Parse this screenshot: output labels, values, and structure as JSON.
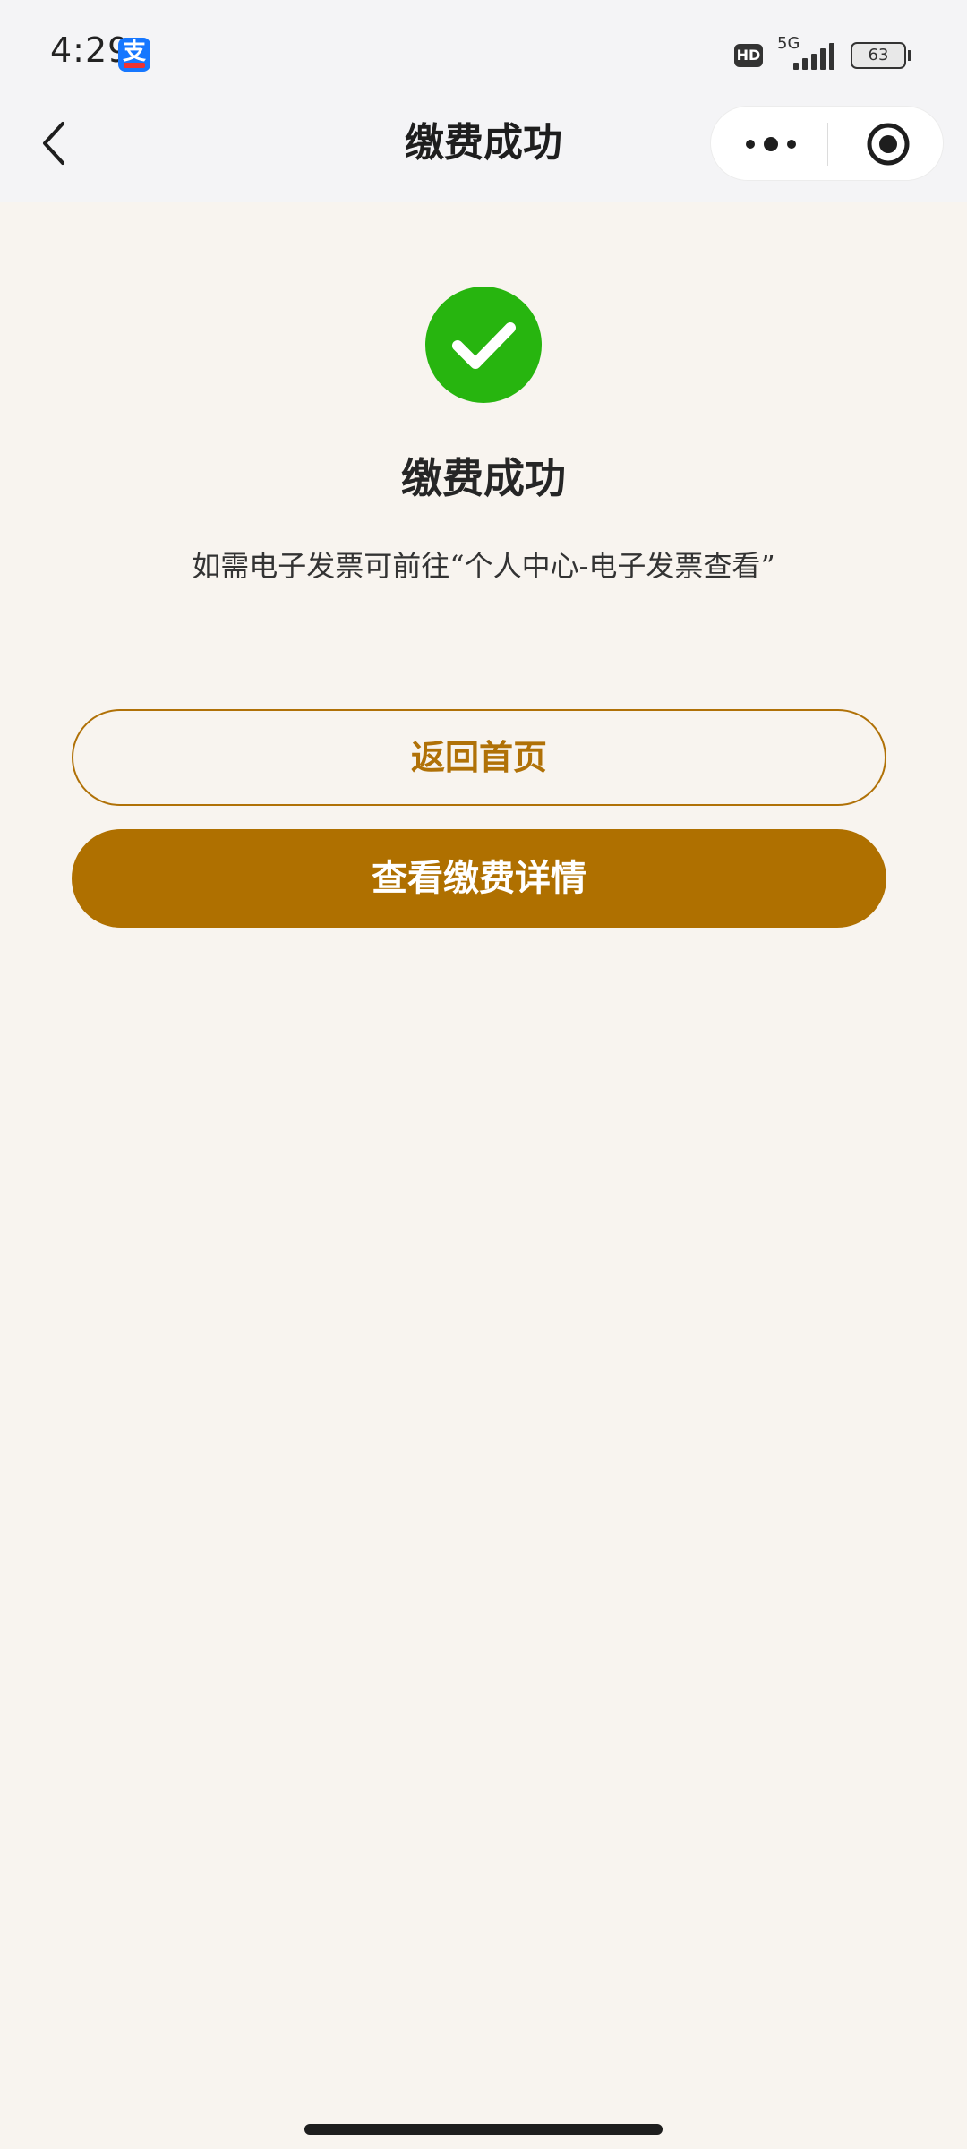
{
  "status_bar": {
    "time": "4:29",
    "app_icon_glyph": "支",
    "hd_label": "HD",
    "network_label": "5G",
    "battery_level": "63"
  },
  "nav": {
    "title": "缴费成功"
  },
  "result": {
    "title": "缴费成功",
    "hint": "如需电子发票可前往“个人中心-电子发票查看”"
  },
  "buttons": {
    "home_label": "返回首页",
    "detail_label": "查看缴费详情"
  },
  "colors": {
    "accent": "#af7000",
    "success": "#27b50f",
    "background": "#f8f4ef"
  },
  "icons": {
    "back": "back-arrow-icon",
    "more": "more-dots-icon",
    "close": "close-miniprogram-icon",
    "success": "check-circle-icon"
  }
}
